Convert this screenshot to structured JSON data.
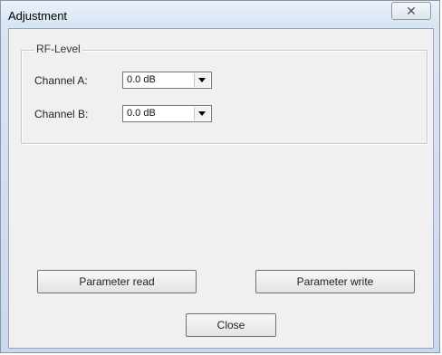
{
  "window": {
    "title": "Adjustment",
    "close_glyph": "✕"
  },
  "rf_level": {
    "group_label": "RF-Level",
    "channel_a": {
      "label": "Channel A:",
      "value": "0.0 dB"
    },
    "channel_b": {
      "label": "Channel B:",
      "value": "0.0 dB"
    }
  },
  "buttons": {
    "parameter_read": "Parameter read",
    "parameter_write": "Parameter write",
    "close": "Close"
  }
}
